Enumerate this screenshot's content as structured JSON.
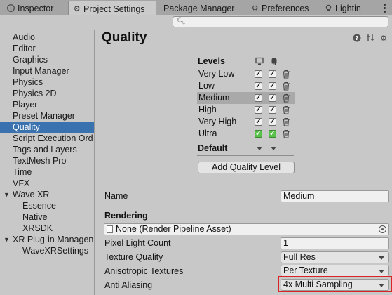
{
  "tabs": [
    {
      "label": "Inspector",
      "icon": "info-icon"
    },
    {
      "label": "Project Settings",
      "icon": "gear-icon"
    },
    {
      "label": "Package Manager",
      "icon": "package-icon"
    },
    {
      "label": "Preferences",
      "icon": "gear-icon"
    },
    {
      "label": "Lightin",
      "icon": "lighting-icon"
    }
  ],
  "search": {
    "placeholder": ""
  },
  "sidebar": {
    "items": [
      {
        "label": "Audio"
      },
      {
        "label": "Editor"
      },
      {
        "label": "Graphics"
      },
      {
        "label": "Input Manager"
      },
      {
        "label": "Physics"
      },
      {
        "label": "Physics 2D"
      },
      {
        "label": "Player"
      },
      {
        "label": "Preset Manager"
      },
      {
        "label": "Quality",
        "selected": true
      },
      {
        "label": "Script Execution Ord"
      },
      {
        "label": "Tags and Layers"
      },
      {
        "label": "TextMesh Pro"
      },
      {
        "label": "Time"
      },
      {
        "label": "VFX"
      },
      {
        "label": "Wave XR",
        "expanded": true
      },
      {
        "label": "Essence"
      },
      {
        "label": "Native"
      },
      {
        "label": "XRSDK"
      },
      {
        "label": "XR Plug-in Managen",
        "expanded": true
      },
      {
        "label": "WaveXRSettings"
      }
    ]
  },
  "main": {
    "title": "Quality",
    "levels_label": "Levels",
    "levels": [
      {
        "name": "Very Low",
        "desktop": true,
        "android": true,
        "default": false
      },
      {
        "name": "Low",
        "desktop": true,
        "android": true,
        "default": false
      },
      {
        "name": "Medium",
        "desktop": true,
        "android": true,
        "default": false,
        "selected": true
      },
      {
        "name": "High",
        "desktop": true,
        "android": true,
        "default": false
      },
      {
        "name": "Very High",
        "desktop": true,
        "android": true,
        "default": false
      },
      {
        "name": "Ultra",
        "desktop": true,
        "android": true,
        "default": true
      }
    ],
    "default_label": "Default",
    "add_button": "Add Quality Level",
    "name_label": "Name",
    "name_value": "Medium",
    "rendering_header": "Rendering",
    "render_pipeline": "None (Render Pipeline Asset)",
    "pixel_light_label": "Pixel Light Count",
    "pixel_light_value": "1",
    "texture_quality_label": "Texture Quality",
    "texture_quality_value": "Full Res",
    "aniso_label": "Anisotropic Textures",
    "aniso_value": "Per Texture",
    "aa_label": "Anti Aliasing",
    "aa_value": "4x Multi Sampling"
  },
  "colors": {
    "selection": "#3a72b0",
    "default_check": "#58c14a",
    "highlight_box": "#d9242a"
  }
}
